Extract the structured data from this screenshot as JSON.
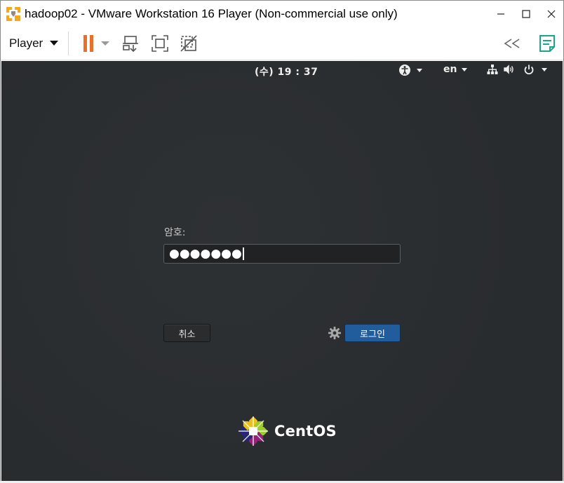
{
  "window": {
    "title": "hadoop02 - VMware Workstation 16 Player (Non-commercial use only)",
    "controls": {
      "minimize": "minimize-icon",
      "maximize": "maximize-icon",
      "close": "close-icon"
    }
  },
  "toolbar": {
    "player_label": "Player",
    "icons": [
      "pause-icon",
      "send-ctrl-alt-del-icon",
      "fullscreen-icon",
      "unity-icon",
      "collapse-icon",
      "notes-icon"
    ],
    "pause_color": "#e8702a",
    "notes_color": "#1aa58f"
  },
  "vm": {
    "topbar": {
      "clock": "(수) 19 : 37",
      "language": "en"
    },
    "login": {
      "password_label": "암호:",
      "password_value": "●●●●●●●",
      "cancel_label": "취소",
      "login_label": "로그인"
    },
    "logo_text": "CentOS"
  }
}
